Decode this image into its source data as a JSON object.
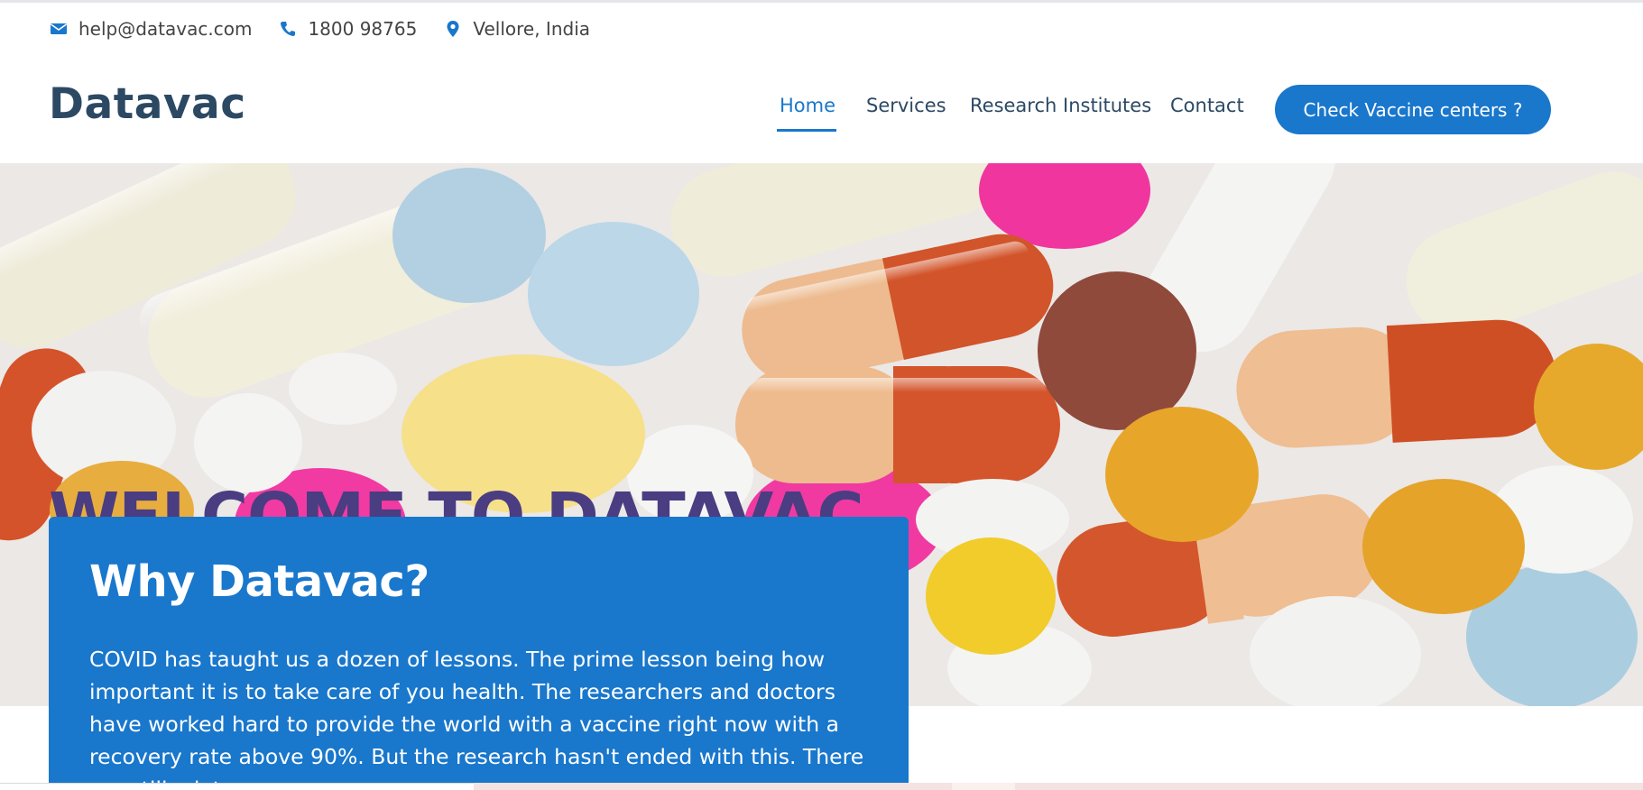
{
  "topbar": {
    "email": "help@datavac.com",
    "phone": "1800 98765",
    "location": "Vellore, India",
    "email_icon": "envelope-icon",
    "phone_icon": "phone-icon",
    "location_icon": "map-marker-icon"
  },
  "header": {
    "logo": "Datavac",
    "nav": {
      "home": "Home",
      "services": "Services",
      "research": "Research Institutes",
      "contact": "Contact"
    },
    "active_nav": "Home",
    "cta": "Check Vaccine centers ?"
  },
  "hero": {
    "title": "WELCOME TO DATAVAC"
  },
  "why": {
    "title": "Why Datavac?",
    "text": "COVID has taught us a dozen of lessons. The prime lesson being how important it is to take care of you health. The researchers and doctors have worked hard to provide the world with a vaccine right now with a recovery rate above 90%. But the research hasn't ended with this. There are still a lot"
  },
  "colors": {
    "accent": "#1977cc",
    "heading": "#2c4964",
    "hero_title": "#4a3d82",
    "text": "#444444"
  }
}
